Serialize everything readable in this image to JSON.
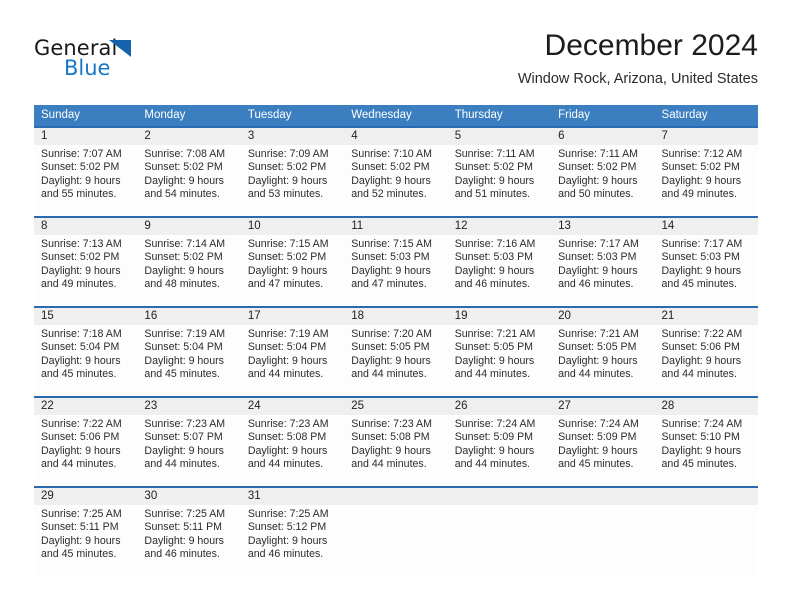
{
  "logo": {
    "word1": "General",
    "word2": "Blue",
    "triangle_color": "#1464ac",
    "blue_text_color": "#1877c4"
  },
  "header": {
    "month_title": "December 2024",
    "location": "Window Rock, Arizona, United States"
  },
  "theme": {
    "header_bg": "#3c7fc0",
    "separator": "#2a6ab0",
    "daynum_bg": "#efefef",
    "cell_bg": "#fdfdfd",
    "text": "#2b2b2b"
  },
  "weekday_headers": [
    "Sunday",
    "Monday",
    "Tuesday",
    "Wednesday",
    "Thursday",
    "Friday",
    "Saturday"
  ],
  "weeks": [
    {
      "days": [
        {
          "num": "1",
          "l1": "Sunrise: 7:07 AM",
          "l2": "Sunset: 5:02 PM",
          "l3": "Daylight: 9 hours",
          "l4": "and 55 minutes."
        },
        {
          "num": "2",
          "l1": "Sunrise: 7:08 AM",
          "l2": "Sunset: 5:02 PM",
          "l3": "Daylight: 9 hours",
          "l4": "and 54 minutes."
        },
        {
          "num": "3",
          "l1": "Sunrise: 7:09 AM",
          "l2": "Sunset: 5:02 PM",
          "l3": "Daylight: 9 hours",
          "l4": "and 53 minutes."
        },
        {
          "num": "4",
          "l1": "Sunrise: 7:10 AM",
          "l2": "Sunset: 5:02 PM",
          "l3": "Daylight: 9 hours",
          "l4": "and 52 minutes."
        },
        {
          "num": "5",
          "l1": "Sunrise: 7:11 AM",
          "l2": "Sunset: 5:02 PM",
          "l3": "Daylight: 9 hours",
          "l4": "and 51 minutes."
        },
        {
          "num": "6",
          "l1": "Sunrise: 7:11 AM",
          "l2": "Sunset: 5:02 PM",
          "l3": "Daylight: 9 hours",
          "l4": "and 50 minutes."
        },
        {
          "num": "7",
          "l1": "Sunrise: 7:12 AM",
          "l2": "Sunset: 5:02 PM",
          "l3": "Daylight: 9 hours",
          "l4": "and 49 minutes."
        }
      ]
    },
    {
      "days": [
        {
          "num": "8",
          "l1": "Sunrise: 7:13 AM",
          "l2": "Sunset: 5:02 PM",
          "l3": "Daylight: 9 hours",
          "l4": "and 49 minutes."
        },
        {
          "num": "9",
          "l1": "Sunrise: 7:14 AM",
          "l2": "Sunset: 5:02 PM",
          "l3": "Daylight: 9 hours",
          "l4": "and 48 minutes."
        },
        {
          "num": "10",
          "l1": "Sunrise: 7:15 AM",
          "l2": "Sunset: 5:02 PM",
          "l3": "Daylight: 9 hours",
          "l4": "and 47 minutes."
        },
        {
          "num": "11",
          "l1": "Sunrise: 7:15 AM",
          "l2": "Sunset: 5:03 PM",
          "l3": "Daylight: 9 hours",
          "l4": "and 47 minutes."
        },
        {
          "num": "12",
          "l1": "Sunrise: 7:16 AM",
          "l2": "Sunset: 5:03 PM",
          "l3": "Daylight: 9 hours",
          "l4": "and 46 minutes."
        },
        {
          "num": "13",
          "l1": "Sunrise: 7:17 AM",
          "l2": "Sunset: 5:03 PM",
          "l3": "Daylight: 9 hours",
          "l4": "and 46 minutes."
        },
        {
          "num": "14",
          "l1": "Sunrise: 7:17 AM",
          "l2": "Sunset: 5:03 PM",
          "l3": "Daylight: 9 hours",
          "l4": "and 45 minutes."
        }
      ]
    },
    {
      "days": [
        {
          "num": "15",
          "l1": "Sunrise: 7:18 AM",
          "l2": "Sunset: 5:04 PM",
          "l3": "Daylight: 9 hours",
          "l4": "and 45 minutes."
        },
        {
          "num": "16",
          "l1": "Sunrise: 7:19 AM",
          "l2": "Sunset: 5:04 PM",
          "l3": "Daylight: 9 hours",
          "l4": "and 45 minutes."
        },
        {
          "num": "17",
          "l1": "Sunrise: 7:19 AM",
          "l2": "Sunset: 5:04 PM",
          "l3": "Daylight: 9 hours",
          "l4": "and 44 minutes."
        },
        {
          "num": "18",
          "l1": "Sunrise: 7:20 AM",
          "l2": "Sunset: 5:05 PM",
          "l3": "Daylight: 9 hours",
          "l4": "and 44 minutes."
        },
        {
          "num": "19",
          "l1": "Sunrise: 7:21 AM",
          "l2": "Sunset: 5:05 PM",
          "l3": "Daylight: 9 hours",
          "l4": "and 44 minutes."
        },
        {
          "num": "20",
          "l1": "Sunrise: 7:21 AM",
          "l2": "Sunset: 5:05 PM",
          "l3": "Daylight: 9 hours",
          "l4": "and 44 minutes."
        },
        {
          "num": "21",
          "l1": "Sunrise: 7:22 AM",
          "l2": "Sunset: 5:06 PM",
          "l3": "Daylight: 9 hours",
          "l4": "and 44 minutes."
        }
      ]
    },
    {
      "days": [
        {
          "num": "22",
          "l1": "Sunrise: 7:22 AM",
          "l2": "Sunset: 5:06 PM",
          "l3": "Daylight: 9 hours",
          "l4": "and 44 minutes."
        },
        {
          "num": "23",
          "l1": "Sunrise: 7:23 AM",
          "l2": "Sunset: 5:07 PM",
          "l3": "Daylight: 9 hours",
          "l4": "and 44 minutes."
        },
        {
          "num": "24",
          "l1": "Sunrise: 7:23 AM",
          "l2": "Sunset: 5:08 PM",
          "l3": "Daylight: 9 hours",
          "l4": "and 44 minutes."
        },
        {
          "num": "25",
          "l1": "Sunrise: 7:23 AM",
          "l2": "Sunset: 5:08 PM",
          "l3": "Daylight: 9 hours",
          "l4": "and 44 minutes."
        },
        {
          "num": "26",
          "l1": "Sunrise: 7:24 AM",
          "l2": "Sunset: 5:09 PM",
          "l3": "Daylight: 9 hours",
          "l4": "and 44 minutes."
        },
        {
          "num": "27",
          "l1": "Sunrise: 7:24 AM",
          "l2": "Sunset: 5:09 PM",
          "l3": "Daylight: 9 hours",
          "l4": "and 45 minutes."
        },
        {
          "num": "28",
          "l1": "Sunrise: 7:24 AM",
          "l2": "Sunset: 5:10 PM",
          "l3": "Daylight: 9 hours",
          "l4": "and 45 minutes."
        }
      ]
    },
    {
      "days": [
        {
          "num": "29",
          "l1": "Sunrise: 7:25 AM",
          "l2": "Sunset: 5:11 PM",
          "l3": "Daylight: 9 hours",
          "l4": "and 45 minutes."
        },
        {
          "num": "30",
          "l1": "Sunrise: 7:25 AM",
          "l2": "Sunset: 5:11 PM",
          "l3": "Daylight: 9 hours",
          "l4": "and 46 minutes."
        },
        {
          "num": "31",
          "l1": "Sunrise: 7:25 AM",
          "l2": "Sunset: 5:12 PM",
          "l3": "Daylight: 9 hours",
          "l4": "and 46 minutes."
        },
        {
          "num": "",
          "l1": "",
          "l2": "",
          "l3": "",
          "l4": ""
        },
        {
          "num": "",
          "l1": "",
          "l2": "",
          "l3": "",
          "l4": ""
        },
        {
          "num": "",
          "l1": "",
          "l2": "",
          "l3": "",
          "l4": ""
        },
        {
          "num": "",
          "l1": "",
          "l2": "",
          "l3": "",
          "l4": ""
        }
      ]
    }
  ]
}
